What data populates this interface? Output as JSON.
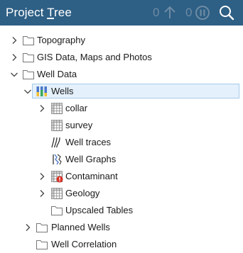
{
  "header": {
    "title_prefix": "Project ",
    "title_underlined": "T",
    "title_suffix": "ree",
    "counter_left": "0",
    "counter_right": "0",
    "icons": [
      "arrow-up-icon",
      "pause-circle-icon",
      "search-icon"
    ],
    "background": "#2e5f85"
  },
  "tree": {
    "items": [
      {
        "label": "Topography",
        "icon": "folder-icon",
        "expander": "collapsed"
      },
      {
        "label": "GIS Data, Maps and Photos",
        "icon": "folder-icon",
        "expander": "collapsed"
      },
      {
        "label": "Well Data",
        "icon": "folder-icon",
        "expander": "expanded"
      },
      {
        "label": "Wells",
        "icon": "wells-icon",
        "expander": "expanded",
        "selected": true
      },
      {
        "label": "collar",
        "icon": "table-icon",
        "expander": "collapsed"
      },
      {
        "label": "survey",
        "icon": "table-icon",
        "expander": "none"
      },
      {
        "label": "Well traces",
        "icon": "well-traces-icon",
        "expander": "none"
      },
      {
        "label": "Well Graphs",
        "icon": "well-graphs-icon",
        "expander": "none"
      },
      {
        "label": "Contaminant",
        "icon": "table-error-icon",
        "expander": "collapsed"
      },
      {
        "label": "Geology",
        "icon": "table-icon",
        "expander": "collapsed"
      },
      {
        "label": "Upscaled Tables",
        "icon": "folder-icon",
        "expander": "none"
      },
      {
        "label": "Planned Wells",
        "icon": "folder-icon",
        "expander": "collapsed"
      },
      {
        "label": "Well Correlation",
        "icon": "folder-icon",
        "expander": "none"
      }
    ]
  },
  "colors": {
    "selection_fill": "#e4f0fb",
    "selection_border": "#a6cbea",
    "error_badge": "#d93025"
  }
}
